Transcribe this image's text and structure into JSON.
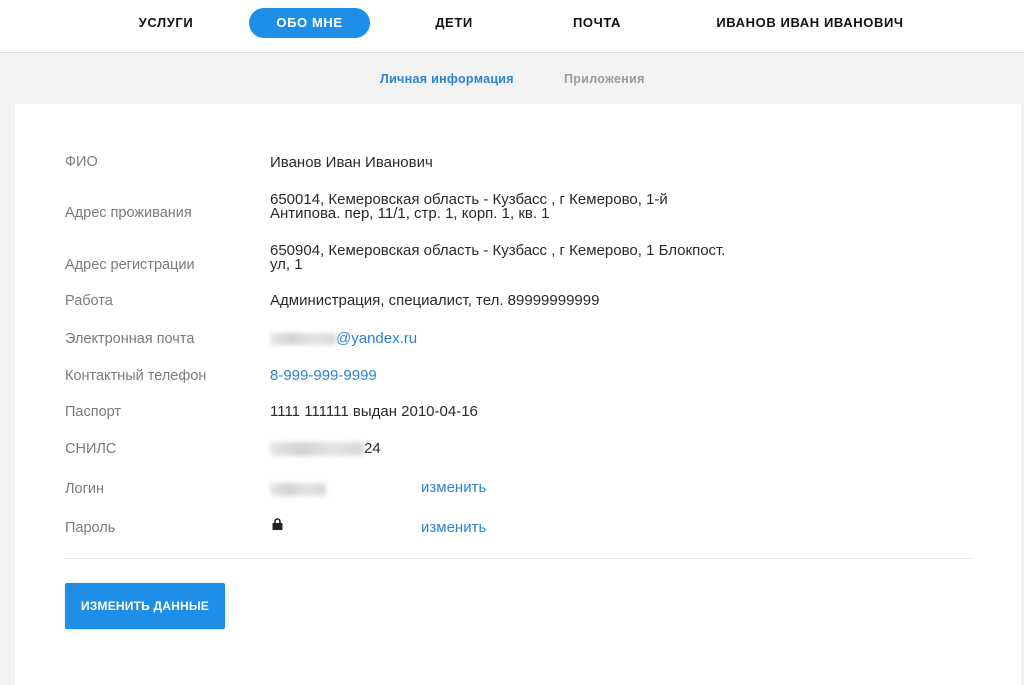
{
  "topnav": {
    "items": [
      {
        "label": "УСЛУГИ"
      },
      {
        "label": "ОБО МНЕ"
      },
      {
        "label": "ДЕТИ"
      },
      {
        "label": "ПОЧТА"
      },
      {
        "label": "ИВАНОВ ИВАН ИВАНОВИЧ"
      }
    ],
    "active_index": 1
  },
  "subtabs": [
    {
      "label": "Личная информация",
      "active": true
    },
    {
      "label": "Приложения",
      "active": false
    }
  ],
  "profile": {
    "fio": {
      "label": "ФИО",
      "value": "Иванов Иван Иванович"
    },
    "address_live": {
      "label": "Адрес проживания",
      "line1": "650014, Кемеровская область - Кузбасс , г Кемерово, 1-й",
      "line2": "Антипова. пер, 11/1, стр. 1, корп. 1, кв. 1"
    },
    "address_reg": {
      "label": "Адрес регистрации",
      "line1": "650904, Кемеровская область - Кузбасс , г Кемерово, 1 Блокпост.",
      "line2": "ул, 1"
    },
    "work": {
      "label": "Работа",
      "value": "Администрация, специалист, тел. 89999999999"
    },
    "email": {
      "label": "Электронная почта",
      "value_visible": "@yandex.ru"
    },
    "phone": {
      "label": "Контактный телефон",
      "value": "8-999-999-9999"
    },
    "passport": {
      "label": "Паспорт",
      "value": "1111 111111 выдан 2010-04-16"
    },
    "snils": {
      "label": "СНИЛС",
      "value_visible": "24"
    },
    "login": {
      "label": "Логин",
      "change_label": "изменить"
    },
    "password": {
      "label": "Пароль",
      "change_label": "изменить",
      "icon": "lock-icon"
    }
  },
  "actions": {
    "edit_label": "ИЗМЕНИТЬ ДАННЫЕ"
  },
  "colors": {
    "accent": "#1f8ee6",
    "link": "#2a84d6"
  }
}
